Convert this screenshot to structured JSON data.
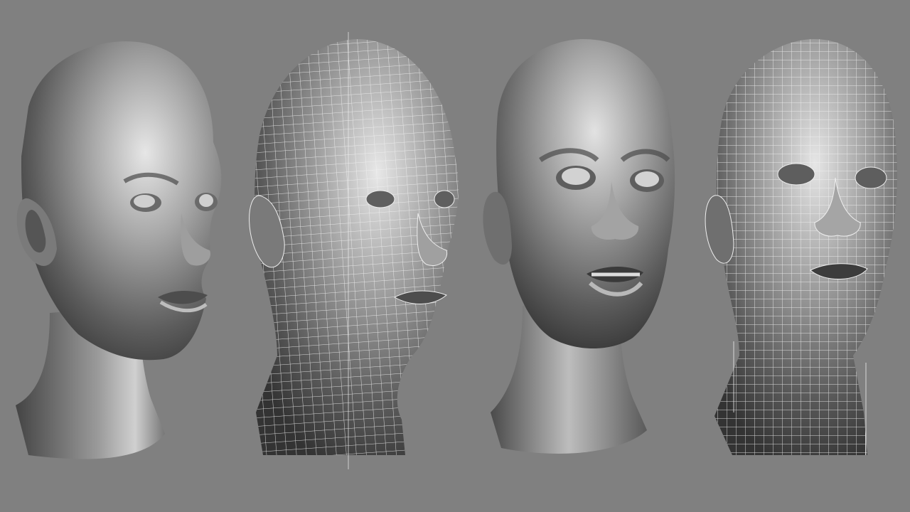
{
  "scene": {
    "background_color": "#808080",
    "heads": [
      {
        "name": "head-smooth-female",
        "render_style": "smooth-shaded",
        "facing": "three-quarter-right",
        "gender": "female"
      },
      {
        "name": "head-wireframe-female",
        "render_style": "smooth-shaded-wireframe-overlay",
        "facing": "three-quarter-right",
        "gender": "female"
      },
      {
        "name": "head-smooth-male",
        "render_style": "smooth-shaded",
        "facing": "front",
        "gender": "male"
      },
      {
        "name": "head-wireframe-male",
        "render_style": "smooth-shaded-wireframe-overlay",
        "facing": "front",
        "gender": "male"
      }
    ],
    "colors": {
      "background": "#808080",
      "surface_light": "#d9d9d9",
      "surface_mid": "#8c8c8c",
      "surface_dark": "#3a3a3a",
      "wire": "#f2f2f2"
    }
  }
}
